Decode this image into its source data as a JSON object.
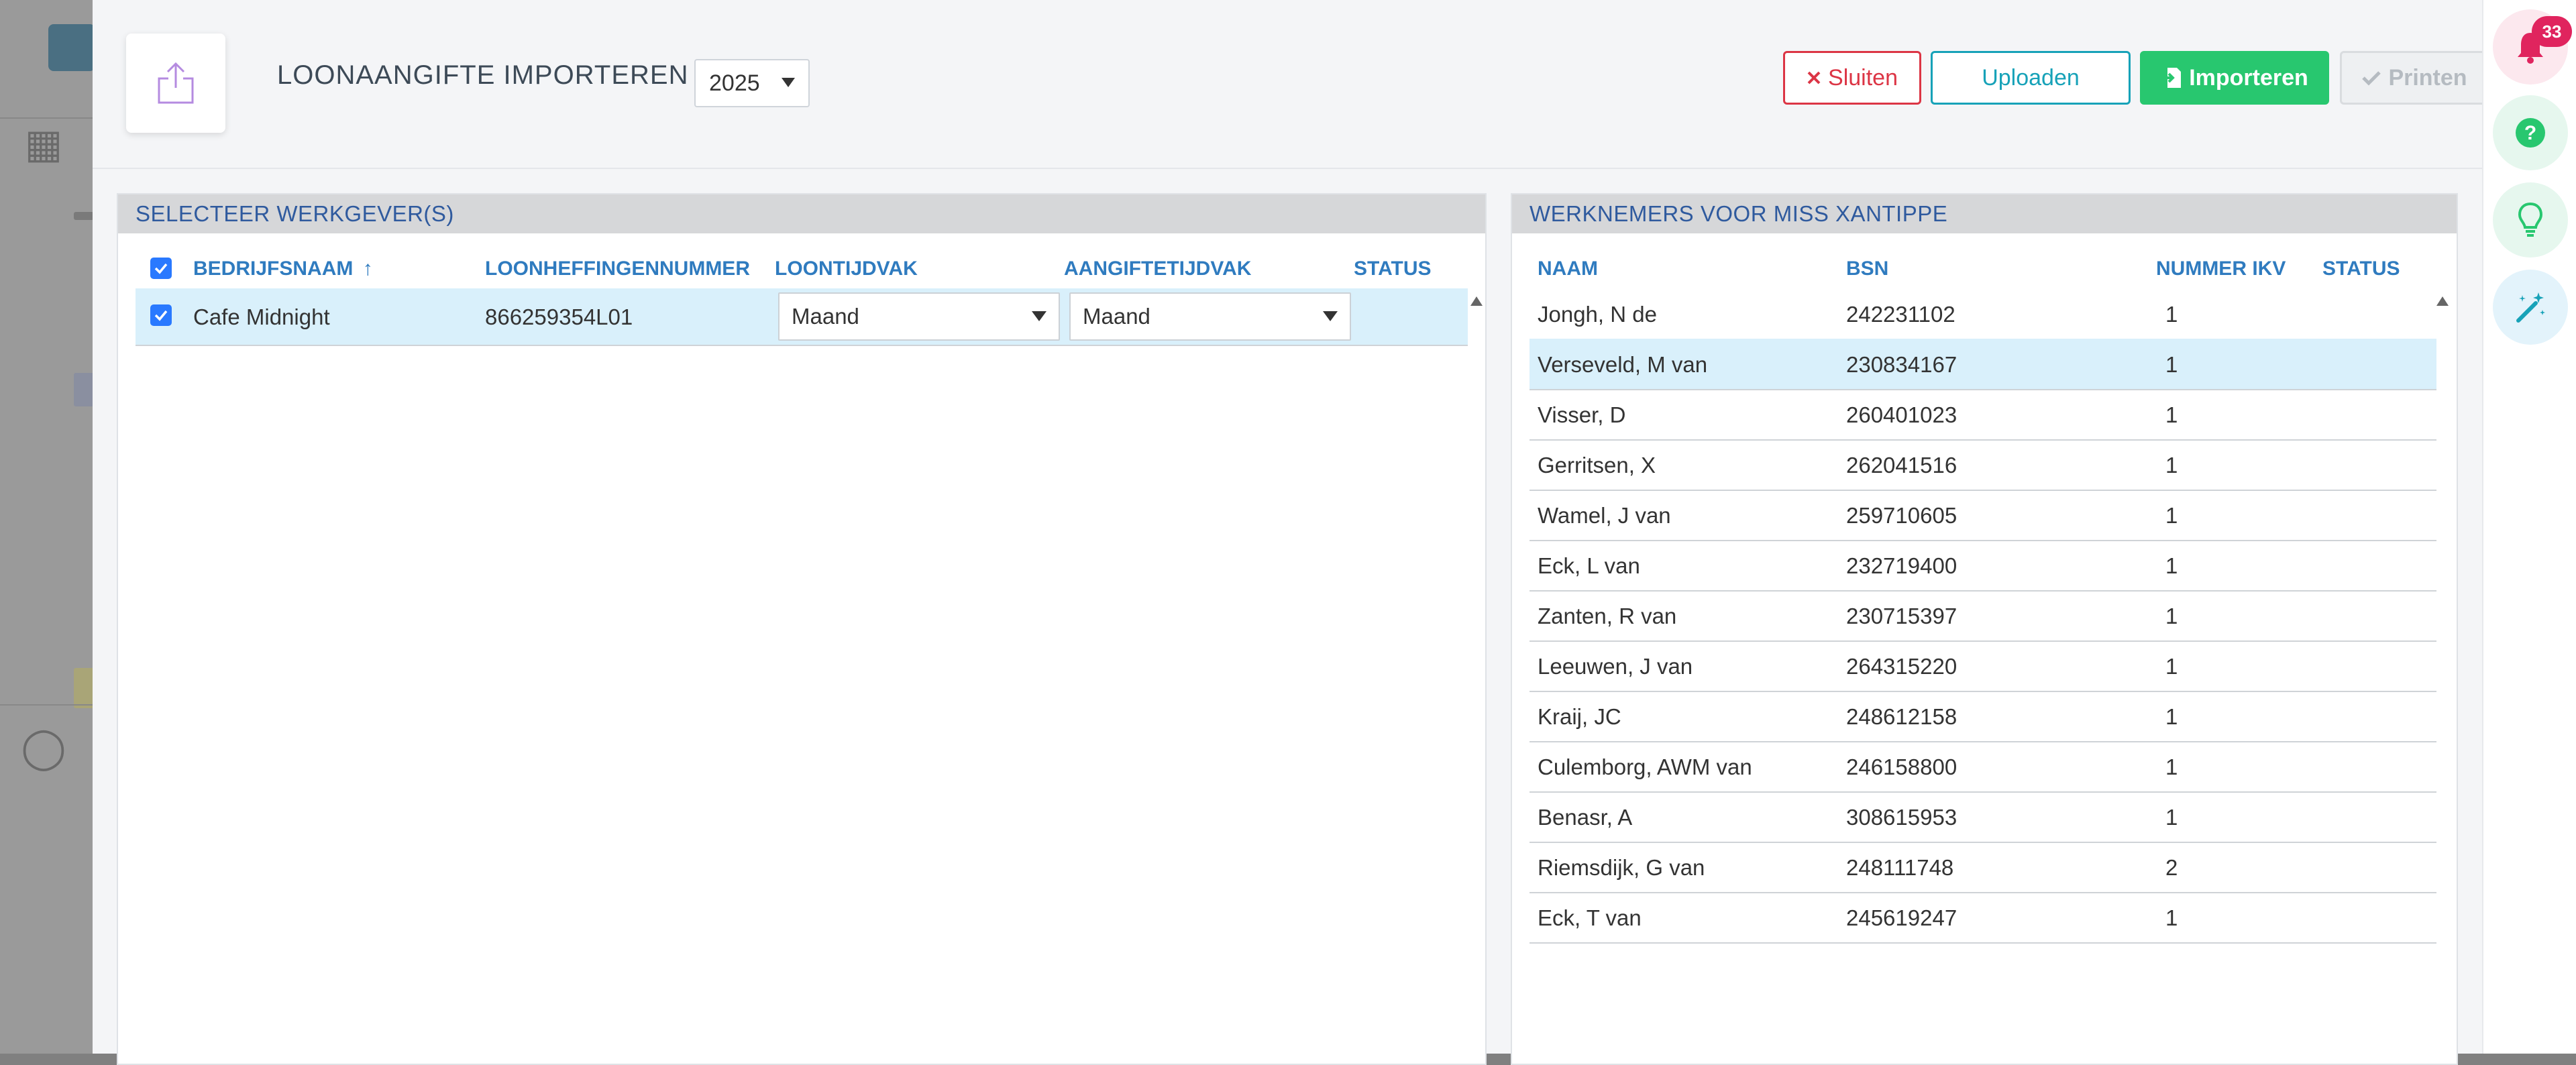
{
  "header": {
    "title": "LOONAANGIFTE IMPORTEREN",
    "year": "2025",
    "buttons": {
      "close": "Sluiten",
      "upload": "Uploaden",
      "import": "Importeren",
      "print": "Printen"
    }
  },
  "left_panel": {
    "title": "SELECTEER WERKGEVER(S)",
    "columns": [
      "BEDRIJFSNAAM",
      "LOONHEFFINGENNUMMER",
      "LOONTIJDVAK",
      "AANGIFTETIJDVAK",
      "STATUS"
    ],
    "sort_indicator": "↑",
    "rows": [
      {
        "checked": true,
        "company": "Cafe Midnight",
        "number": "866259354L01",
        "loontijdvak": "Maand",
        "aangiftetijdvak": "Maand",
        "status": ""
      }
    ]
  },
  "right_panel": {
    "title": "WERKNEMERS VOOR MISS XANTIPPE",
    "columns": [
      "NAAM",
      "BSN",
      "NUMMER IKV",
      "STATUS"
    ],
    "rows": [
      {
        "name": "Jongh, N de",
        "bsn": "242231102",
        "ikv": "1",
        "status": ""
      },
      {
        "name": "Verseveld, M van",
        "bsn": "230834167",
        "ikv": "1",
        "status": ""
      },
      {
        "name": "Visser, D",
        "bsn": "260401023",
        "ikv": "1",
        "status": ""
      },
      {
        "name": "Gerritsen, X",
        "bsn": "262041516",
        "ikv": "1",
        "status": ""
      },
      {
        "name": "Wamel, J van",
        "bsn": "259710605",
        "ikv": "1",
        "status": ""
      },
      {
        "name": "Eck, L van",
        "bsn": "232719400",
        "ikv": "1",
        "status": ""
      },
      {
        "name": "Zanten, R van",
        "bsn": "230715397",
        "ikv": "1",
        "status": ""
      },
      {
        "name": "Leeuwen, J van",
        "bsn": "264315220",
        "ikv": "1",
        "status": ""
      },
      {
        "name": "Kraij, JC",
        "bsn": "248612158",
        "ikv": "1",
        "status": ""
      },
      {
        "name": "Culemborg, AWM van",
        "bsn": "246158800",
        "ikv": "1",
        "status": ""
      },
      {
        "name": "Benasr, A",
        "bsn": "308615953",
        "ikv": "1",
        "status": ""
      },
      {
        "name": "Riemsdijk, G van",
        "bsn": "248111748",
        "ikv": "2",
        "status": ""
      },
      {
        "name": "Eck, T van",
        "bsn": "245619247",
        "ikv": "1",
        "status": ""
      }
    ],
    "selected_row": 1
  },
  "rail": {
    "notification_count": "33",
    "icons": [
      "bell-icon",
      "help-icon",
      "lightbulb-icon",
      "magic-wand-icon"
    ]
  },
  "colors": {
    "accent_blue": "#2f7bbf",
    "close_red": "#dc3545",
    "upload_teal": "#17a2b8",
    "import_green": "#28c76f",
    "row_highlight": "#d9f0fb",
    "badge_red": "#e0245e"
  }
}
